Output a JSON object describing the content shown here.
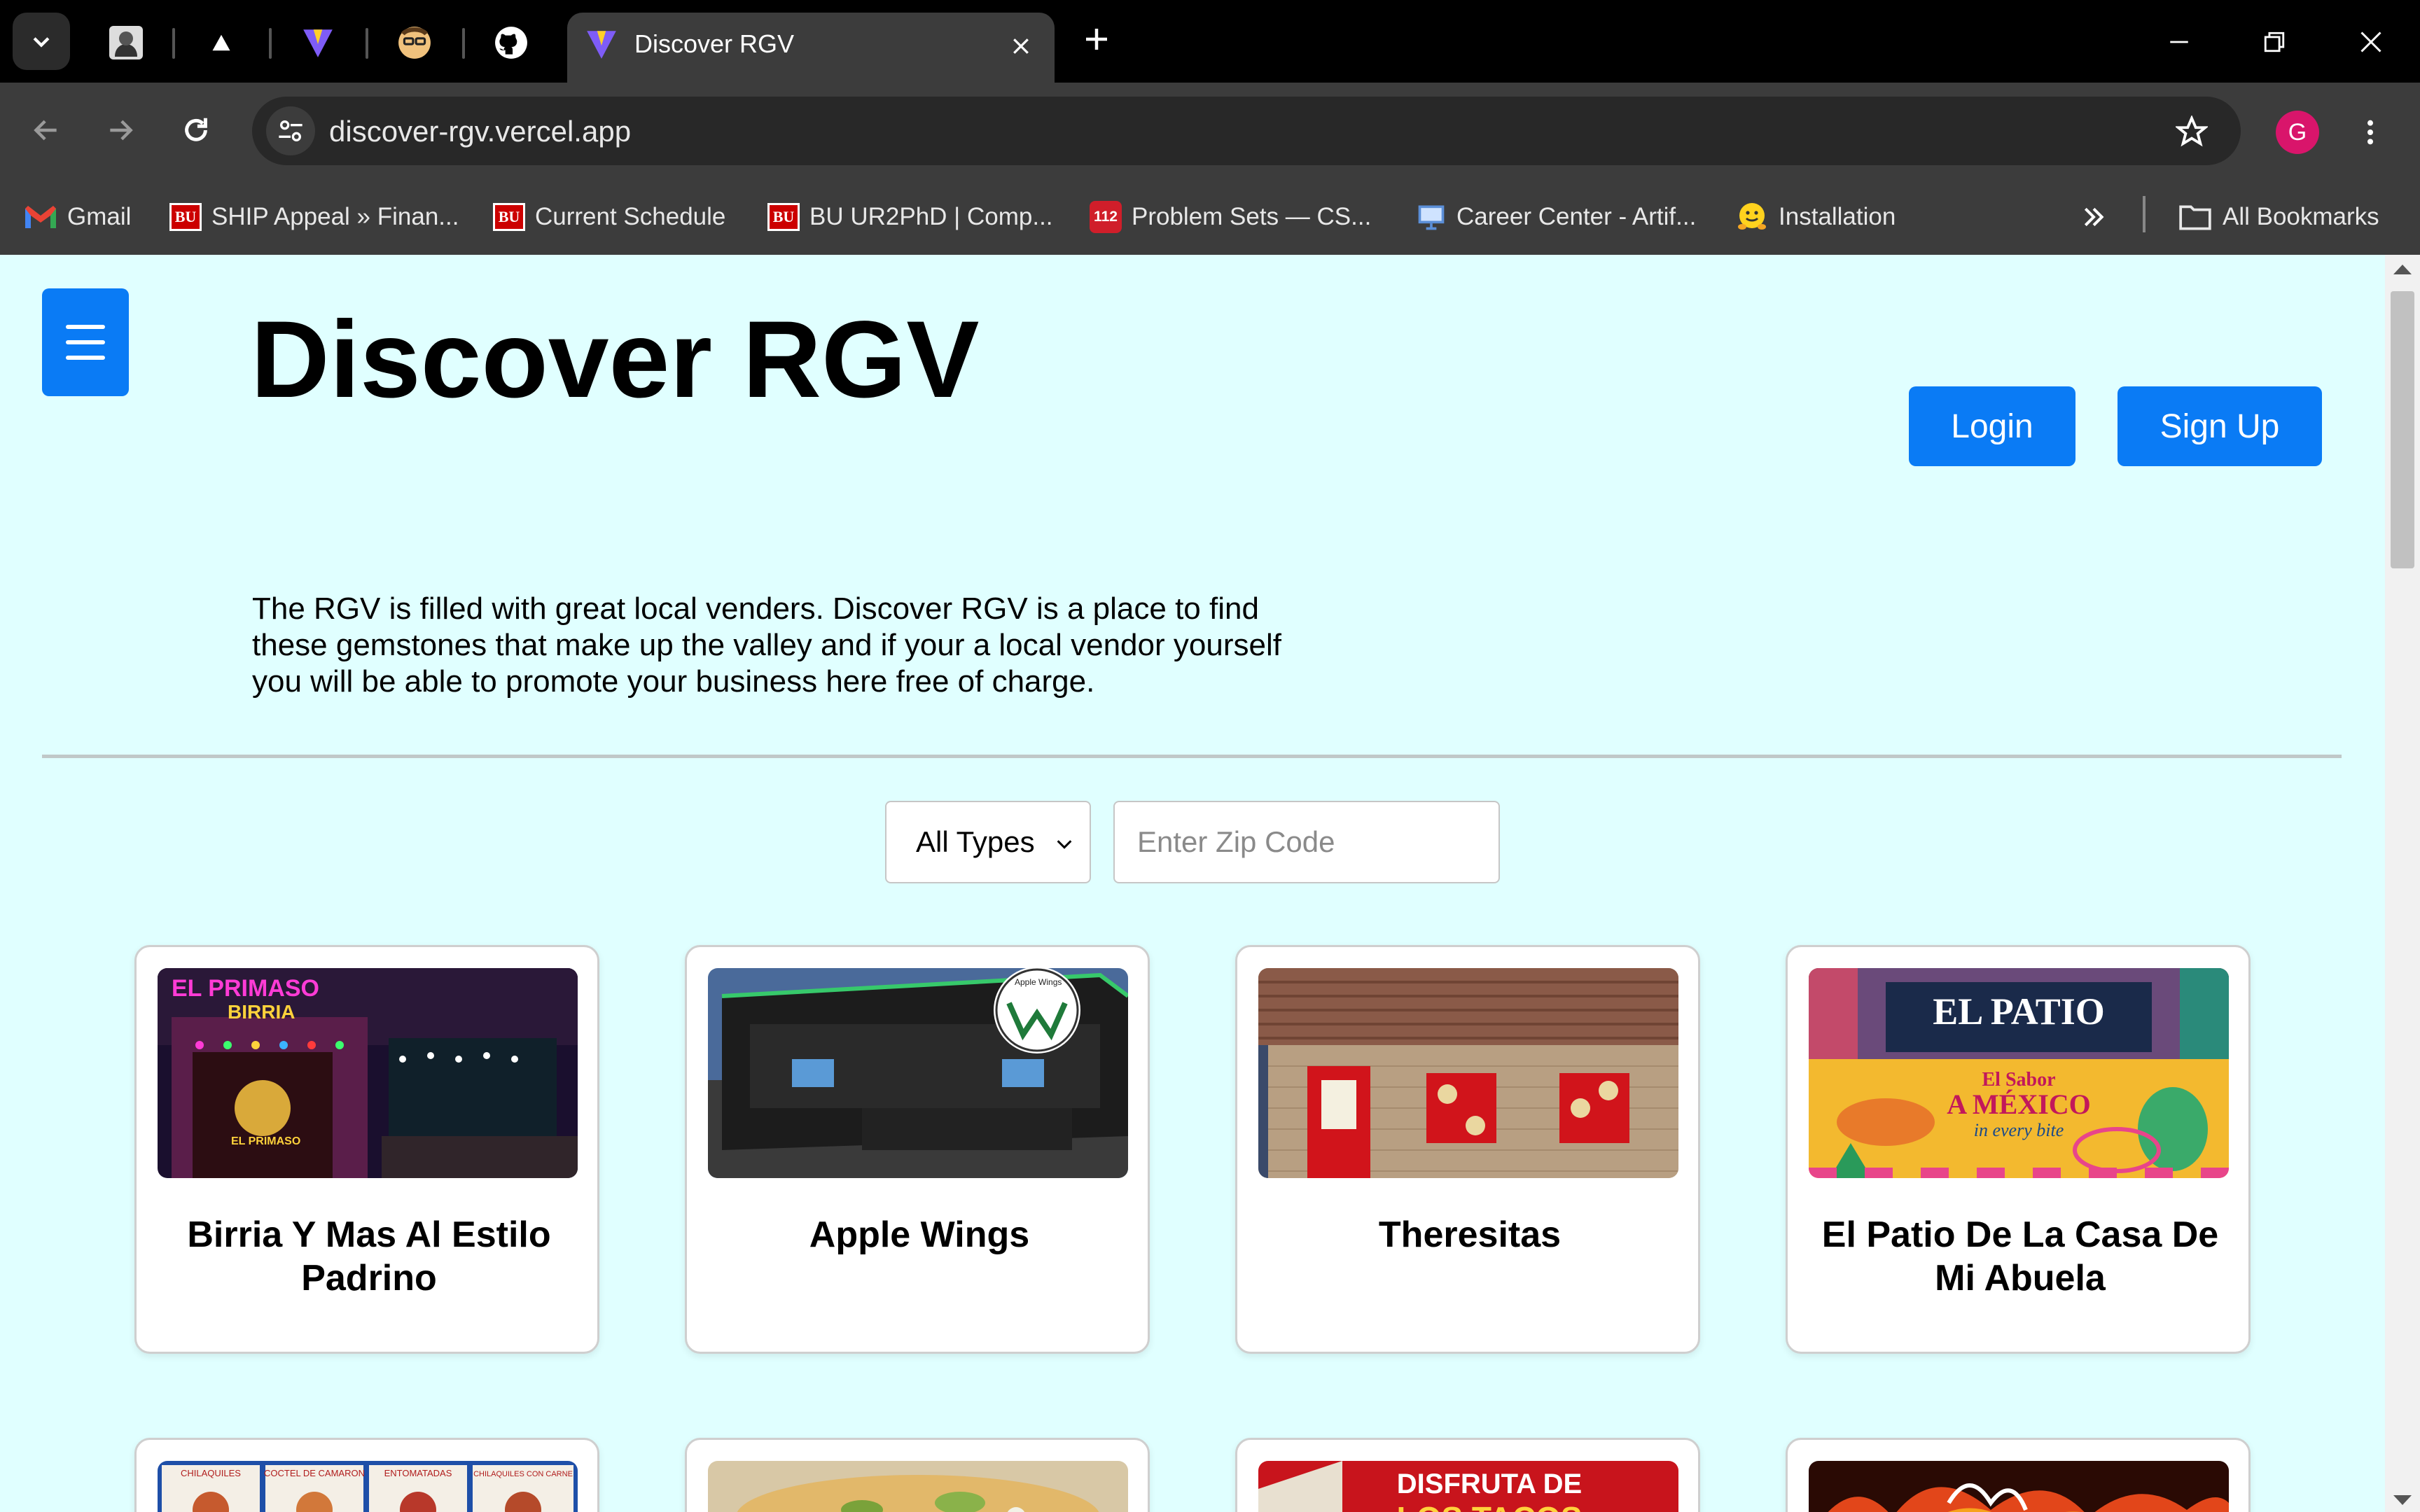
{
  "browser": {
    "active_tab_title": "Discover RGV",
    "url": "discover-rgv.vercel.app",
    "profile_initial": "G",
    "bookmarks": [
      {
        "label": "Gmail",
        "icon": "gmail-icon"
      },
      {
        "label": "SHIP Appeal » Finan...",
        "icon": "bu-icon",
        "badge": "BU"
      },
      {
        "label": "Current Schedule",
        "icon": "bu-icon",
        "badge": "BU"
      },
      {
        "label": "BU UR2PhD | Comp...",
        "icon": "bu-icon",
        "badge": "BU"
      },
      {
        "label": "Problem Sets — CS...",
        "icon": "112-icon",
        "badge": "112"
      },
      {
        "label": "Career Center - Artif...",
        "icon": "monitor-icon"
      },
      {
        "label": "Installation",
        "icon": "hugging-face-icon"
      }
    ],
    "all_bookmarks_label": "All Bookmarks"
  },
  "header": {
    "title": "Discover RGV",
    "login_label": "Login",
    "signup_label": "Sign Up"
  },
  "intro_text": "The RGV is filled with great local venders. Discover RGV is a place to find these gemstones that make up the valley and if your a local vendor yourself you will be able to promote your business here free of charge.",
  "filters": {
    "type_selected": "All Types",
    "zip_placeholder": "Enter Zip Code"
  },
  "vendors": [
    {
      "name": "Birria Y Mas Al Estilo Padrino",
      "sign": "EL PRIMASO",
      "sign_sub": "BIRRIA",
      "door_text": "EL PRIMASO"
    },
    {
      "name": "Apple Wings",
      "logo_text": "Apple Wings"
    },
    {
      "name": "Theresitas"
    },
    {
      "name": "El Patio De La Casa De Mi Abuela",
      "banner_title": "EL PATIO",
      "banner_line1": "El Sabor",
      "banner_line2": "A MÉXICO",
      "banner_line3": "in every bite"
    }
  ],
  "vendors_row2": [
    {
      "img_labels": [
        "CHILAQUILES",
        "COCTEL DE CAMARON",
        "ENTOMATADAS",
        "CHILAQUILES CON CARNE"
      ]
    },
    {},
    {
      "img_text": [
        "DISFRUTA DE",
        "LOS TACOS"
      ]
    },
    {}
  ],
  "colors": {
    "page_bg": "#e0ffff",
    "accent": "#0a7bf5",
    "chrome_dark": "#3c3c3c"
  }
}
